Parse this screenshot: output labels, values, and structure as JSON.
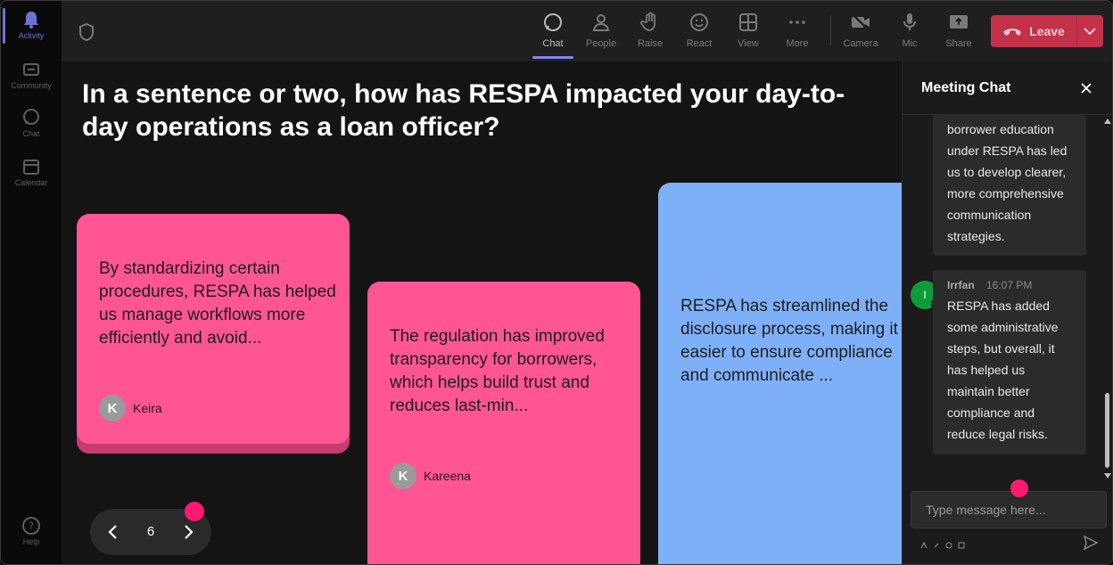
{
  "rail": {
    "items": [
      {
        "label": "Activity",
        "icon": "bell-icon"
      },
      {
        "label": "Community",
        "icon": "community-icon"
      },
      {
        "label": "Chat",
        "icon": "chat-icon"
      },
      {
        "label": "Calendar",
        "icon": "calendar-icon"
      }
    ],
    "help_label": "Help"
  },
  "toolbar": {
    "chat": "Chat",
    "people": "People",
    "raise": "Raise",
    "react": "React",
    "view": "View",
    "more": "More",
    "camera": "Camera",
    "mic": "Mic",
    "share": "Share",
    "leave": "Leave"
  },
  "stage": {
    "question": "In a sentence or two, how has RESPA impacted your day-to-day operations as a loan officer?",
    "cards": [
      {
        "text": "By standardizing certain procedures, RESPA has helped us manage workflows more efficiently and avoid...",
        "author": "Keira",
        "initial": "K"
      },
      {
        "text": "The regulation has improved transparency for borrowers, which helps build trust and reduces last-min...",
        "author": "Kareena",
        "initial": "K"
      },
      {
        "text": "RESPA has streamlined the disclosure process, making it easier to ensure compliance and communicate ..."
      }
    ],
    "page_number": "6"
  },
  "chat": {
    "title": "Meeting Chat",
    "messages": [
      {
        "text": "borrower education\nunder RESPA has led\nus to develop clearer,\nmore comprehensive\ncommunication\nstrategies."
      },
      {
        "author": "Irrfan",
        "time": "16:07 PM",
        "initial": "I",
        "text": "RESPA has added\nsome administrative\nsteps, but overall, it\nhas helped us\nmaintain better\ncompliance and\nreduce legal risks."
      }
    ],
    "input_placeholder": "Type message here..."
  },
  "colors": {
    "accent": "#7f85f5",
    "leave": "#c4314b",
    "card_pink": "#ff5593",
    "card_blue": "#7eb0f7",
    "marker_dot": "#ff1a6c",
    "avatar_green": "#0e9b3a"
  }
}
